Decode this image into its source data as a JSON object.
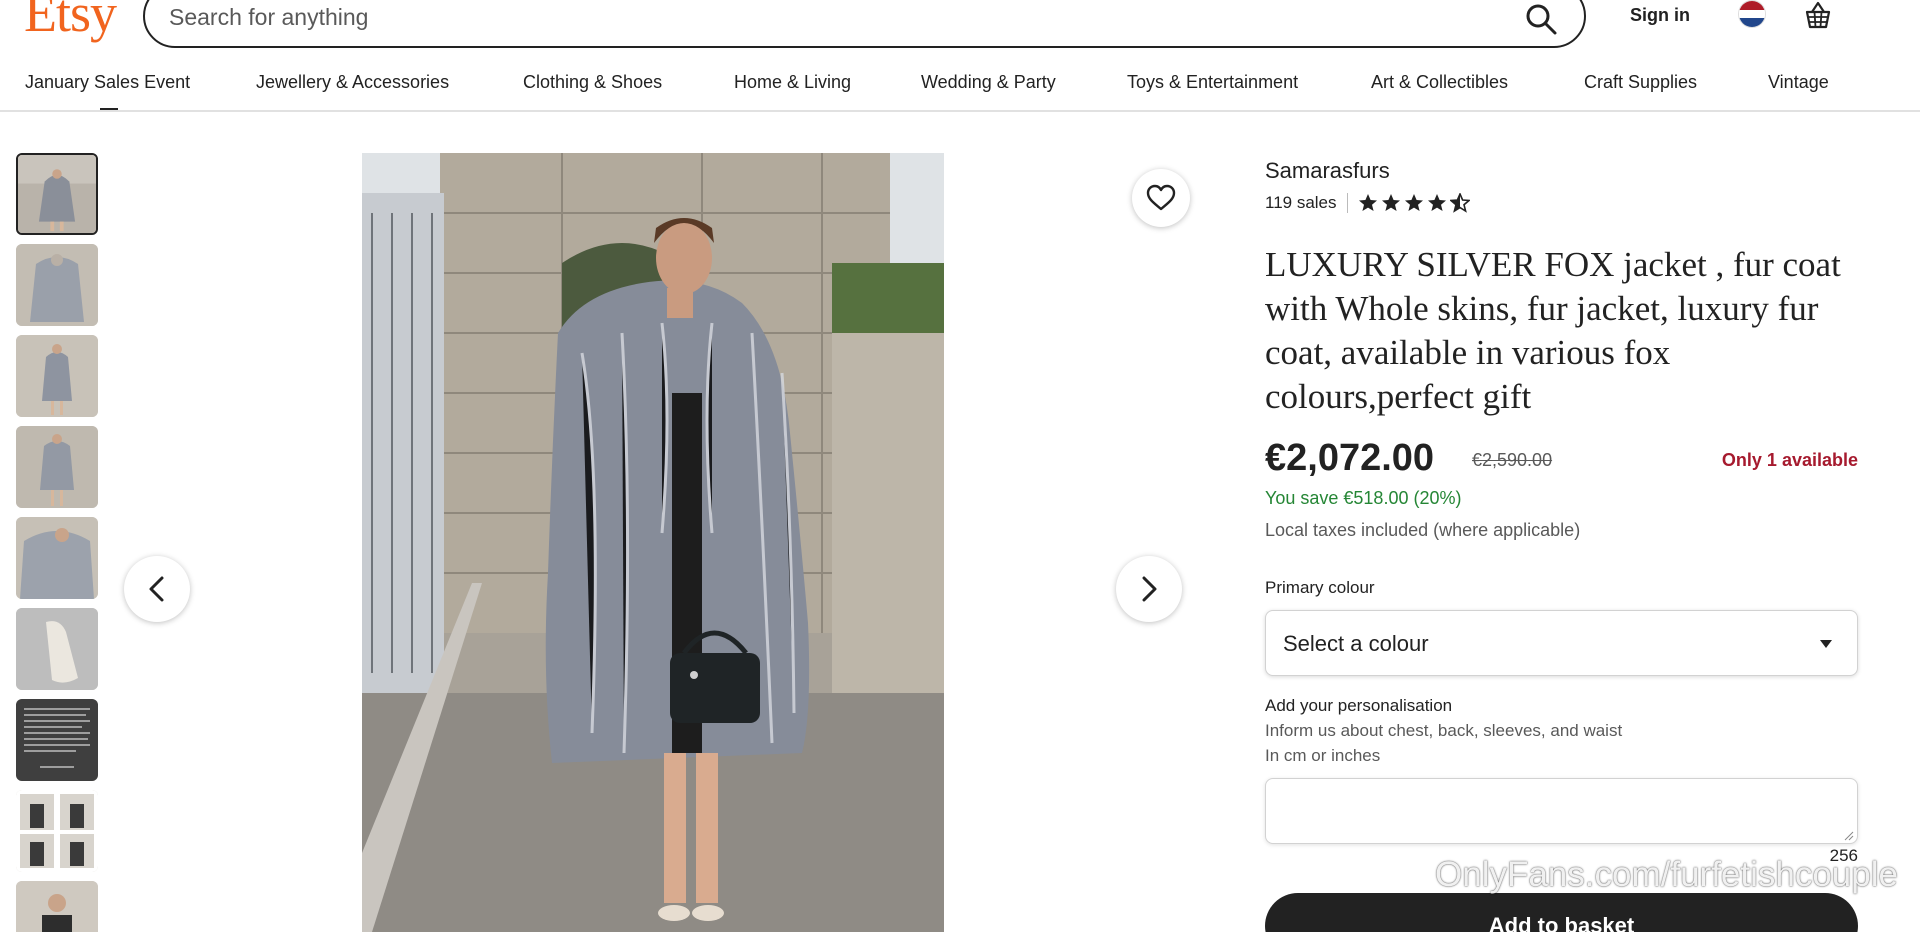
{
  "header": {
    "logo_text": "Etsy",
    "search_placeholder": "Search for anything",
    "sign_in_label": "Sign in",
    "icons": [
      "search-icon",
      "netherlands-flag-icon",
      "basket-icon"
    ]
  },
  "categories": [
    "January Sales Event",
    "Jewellery & Accessories",
    "Clothing & Shoes",
    "Home & Living",
    "Wedding & Party",
    "Toys & Entertainment",
    "Art & Collectibles",
    "Craft Supplies",
    "Vintage"
  ],
  "gallery": {
    "thumbnail_count": 9,
    "selected_index": 0,
    "icons": [
      "chevron-left-icon",
      "chevron-right-icon",
      "heart-icon"
    ]
  },
  "product": {
    "shop_name": "Samarasfurs",
    "sales": "119 sales",
    "rating": 4.5,
    "title": "LUXURY SILVER FOX jacket , fur coat with Whole skins, fur jacket, luxury fur coat, available in various fox colours,perfect gift",
    "price": "€2,072.00",
    "original_price": "€2,590.00",
    "availability": "Only 1 available",
    "savings": "You save €518.00 (20%)",
    "taxes_note": "Local taxes included (where applicable)",
    "colour_label": "Primary colour",
    "colour_select": "Select a colour",
    "personalisation_label": "Add your personalisation",
    "personalisation_hint_1": "Inform us about chest, back, sleeves, and waist",
    "personalisation_hint_2": "In cm or inches",
    "char_count": "256",
    "add_to_basket": "Add to basket"
  },
  "watermark": "OnlyFans.com/furfetishcouple",
  "colors": {
    "brand": "#F1641E",
    "savings": "#258635",
    "availability": "#A61A2E",
    "button": "#222222"
  }
}
